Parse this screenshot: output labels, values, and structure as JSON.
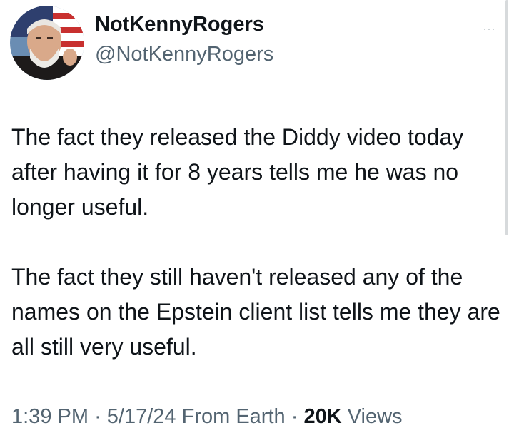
{
  "author": {
    "display_name": "NotKennyRogers",
    "handle": "@NotKennyRogers"
  },
  "menu": {
    "more_glyph": "···"
  },
  "tweet": {
    "paragraphs": [
      "The fact they released the Diddy video today after having it for 8 years tells me he was no longer useful.",
      "The fact they still haven't released any of the names on the Epstein client list tells me they are all still very useful."
    ],
    "time": "1:39 PM",
    "separator": "·",
    "date": "5/17/24",
    "source": "From Earth",
    "views_count": "20K",
    "views_label": "Views"
  },
  "colors": {
    "text_primary": "#0f1419",
    "text_secondary": "#536471"
  }
}
